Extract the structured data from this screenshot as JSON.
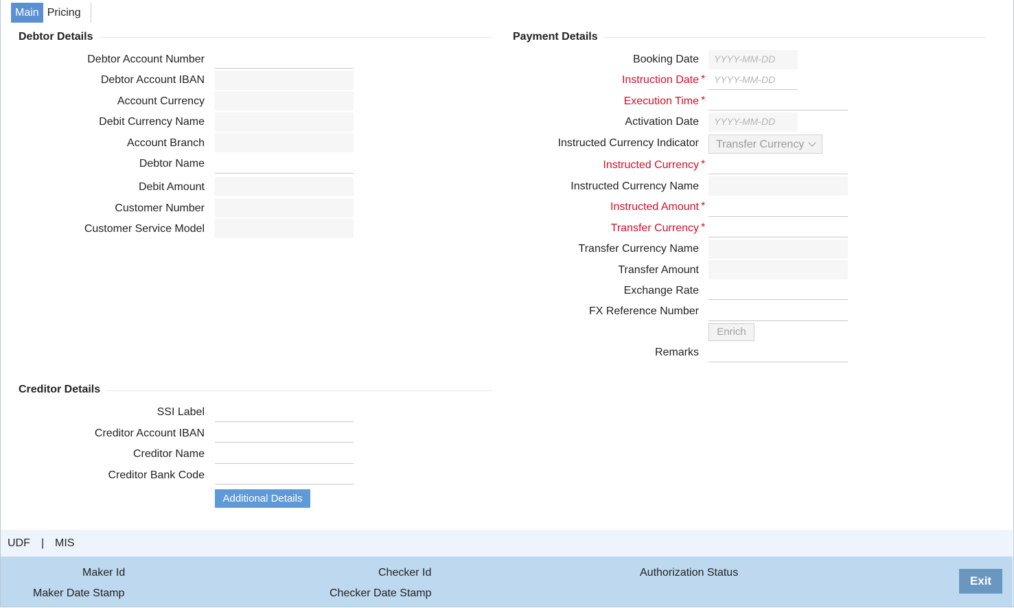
{
  "tabs": {
    "main": "Main",
    "pricing": "Pricing"
  },
  "debtor": {
    "title": "Debtor Details",
    "fields": {
      "account_number": "Debtor Account Number",
      "account_iban": "Debtor Account IBAN",
      "account_currency": "Account Currency",
      "debit_currency_name": "Debit Currency Name",
      "account_branch": "Account Branch",
      "debtor_name": "Debtor Name",
      "debit_amount": "Debit Amount",
      "customer_number": "Customer Number",
      "customer_service_model": "Customer Service Model"
    }
  },
  "payment": {
    "title": "Payment Details",
    "fields": {
      "booking_date": "Booking Date",
      "instruction_date": "Instruction Date",
      "execution_time": "Execution Time",
      "activation_date": "Activation Date",
      "instructed_currency_indicator": "Instructed Currency Indicator",
      "instructed_currency": "Instructed Currency",
      "instructed_currency_name": "Instructed Currency Name",
      "instructed_amount": "Instructed Amount",
      "transfer_currency": "Transfer Currency",
      "transfer_currency_name": "Transfer Currency Name",
      "transfer_amount": "Transfer Amount",
      "exchange_rate": "Exchange Rate",
      "fx_reference_number": "FX Reference Number",
      "remarks": "Remarks"
    },
    "date_placeholder": "YYYY-MM-DD",
    "indicator_value": "Transfer Currency",
    "required_marker": "*",
    "enrich_label": "Enrich"
  },
  "creditor": {
    "title": "Creditor Details",
    "fields": {
      "ssi_label": "SSI Label",
      "account_iban": "Creditor Account IBAN",
      "creditor_name": "Creditor Name",
      "bank_code": "Creditor Bank Code"
    },
    "additional_details_label": "Additional Details"
  },
  "udf_bar": {
    "udf": "UDF",
    "separator": "|",
    "mis": "MIS"
  },
  "footer": {
    "maker_id": "Maker Id",
    "maker_date_stamp": "Maker Date Stamp",
    "checker_id": "Checker Id",
    "checker_date_stamp": "Checker Date Stamp",
    "authorization_status": "Authorization Status",
    "exit_label": "Exit"
  },
  "colors": {
    "tab_active": "#5a8fd1",
    "required": "#d0112b",
    "footer_bg": "#bed8ef",
    "exit_button": "#6a97bf",
    "primary_button": "#5f9ad8"
  }
}
